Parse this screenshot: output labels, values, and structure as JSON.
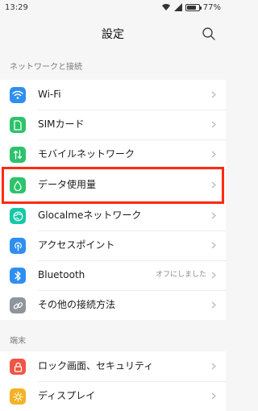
{
  "status_bar": {
    "time": "13:29",
    "battery": "77%",
    "battery_level": 0.77
  },
  "header": {
    "title": "設定"
  },
  "sections": {
    "network": {
      "title": "ネットワークと接続"
    },
    "device": {
      "title": "端末"
    }
  },
  "items": {
    "wifi": {
      "label": "Wi-Fi",
      "icon": "wifi-icon",
      "color": "#2f8ff0"
    },
    "sim": {
      "label": "SIMカード",
      "icon": "sim-card-icon",
      "color": "#2cc36b"
    },
    "mobile": {
      "label": "モバイルネットワーク",
      "icon": "mobile-network-icon",
      "color": "#2cc36b"
    },
    "data": {
      "label": "データ使用量",
      "icon": "data-usage-icon",
      "color": "#2cc36b"
    },
    "glocalme": {
      "label": "Glocalmeネットワーク",
      "icon": "globe-icon",
      "color": "#16c7a8"
    },
    "ap": {
      "label": "アクセスポイント",
      "icon": "hotspot-icon",
      "color": "#2f8ff0"
    },
    "bluetooth": {
      "label": "Bluetooth",
      "value": "オフにしました",
      "icon": "bluetooth-icon",
      "color": "#2f8ff0"
    },
    "other": {
      "label": "その他の接続方法",
      "icon": "link-icon",
      "color": "#8f959c"
    },
    "lock": {
      "label": "ロック画面、セキュリティ",
      "icon": "lock-icon",
      "color": "#f05545"
    },
    "display": {
      "label": "ディスプレイ",
      "icon": "sun-icon",
      "color": "#f3b226"
    }
  },
  "highlight_color": "#ff2a12"
}
